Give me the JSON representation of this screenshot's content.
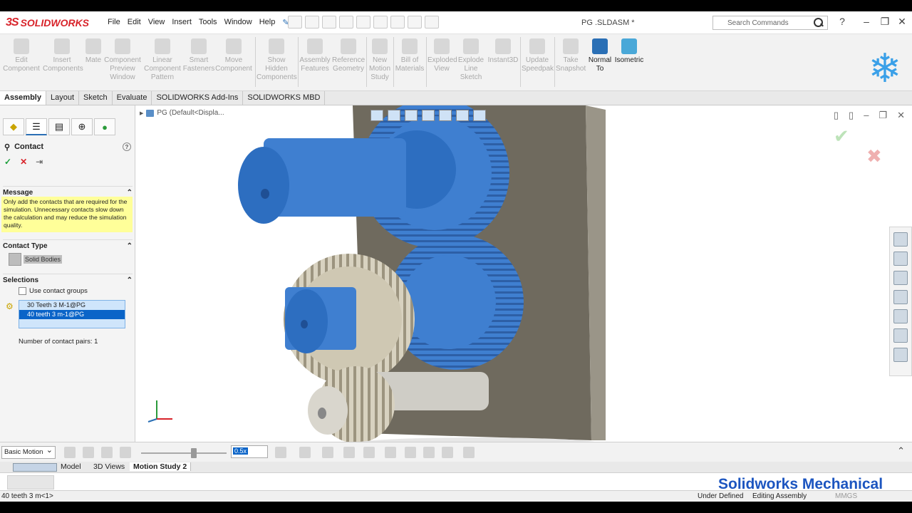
{
  "app": {
    "name": "SOLIDWORKS",
    "doc_title": "PG .SLDASM *"
  },
  "menu": [
    "File",
    "Edit",
    "View",
    "Insert",
    "Tools",
    "Window",
    "Help"
  ],
  "search": {
    "placeholder": "Search Commands"
  },
  "commands": [
    {
      "label": "Edit\nComponent",
      "active": false
    },
    {
      "label": "Insert\nComponents",
      "active": false
    },
    {
      "label": "Mate",
      "active": false
    },
    {
      "label": "Component\nPreview\nWindow",
      "active": false
    },
    {
      "label": "Linear\nComponent\nPattern",
      "active": false
    },
    {
      "label": "Smart\nFasteners",
      "active": false
    },
    {
      "label": "Move\nComponent",
      "active": false
    },
    {
      "label": "Show\nHidden\nComponents",
      "active": false
    },
    {
      "label": "Assembly\nFeatures",
      "active": false
    },
    {
      "label": "Reference\nGeometry",
      "active": false
    },
    {
      "label": "New\nMotion\nStudy",
      "active": false
    },
    {
      "label": "Bill of\nMaterials",
      "active": false
    },
    {
      "label": "Exploded\nView",
      "active": false
    },
    {
      "label": "Explode\nLine\nSketch",
      "active": false
    },
    {
      "label": "Instant3D",
      "active": false
    },
    {
      "label": "Update\nSpeedpak",
      "active": false
    },
    {
      "label": "Take\nSnapshot",
      "active": false
    },
    {
      "label": "Normal\nTo",
      "active": true
    },
    {
      "label": "Isometric",
      "active": true
    }
  ],
  "tabs": [
    "Assembly",
    "Layout",
    "Sketch",
    "Evaluate",
    "SOLIDWORKS Add-Ins",
    "SOLIDWORKS MBD"
  ],
  "property_manager": {
    "title": "Contact",
    "message_header": "Message",
    "message": "Only add the contacts that are required for the simulation. Unnecessary contacts slow down the calculation and may reduce the simulation quality.",
    "contact_type_header": "Contact Type",
    "contact_type_value": "Solid Bodies",
    "selections_header": "Selections",
    "use_groups_label": "Use contact groups",
    "selections": [
      "30 Teeth 3 M-1@PG",
      "40 teeth 3 m-1@PG"
    ],
    "pairs_label": "Number of contact pairs: 1"
  },
  "tree": {
    "root": "PG  (Default<Displa..."
  },
  "motion": {
    "type": "Basic Motion",
    "speed": "0.5x",
    "bottom_tabs": [
      "Model",
      "3D Views",
      "Motion Study 2"
    ]
  },
  "watermark": "Solidworks Mechanical",
  "status": {
    "left": "40 teeth 3 m<1>",
    "under_defined": "Under Defined",
    "editing": "Editing Assembly",
    "units": "MMGS"
  },
  "colors": {
    "accent": "#2a6fb5",
    "gear_blue": "#3f7fd0",
    "gear_tan": "#d8d2c0",
    "plate": "#6f6a5e"
  }
}
